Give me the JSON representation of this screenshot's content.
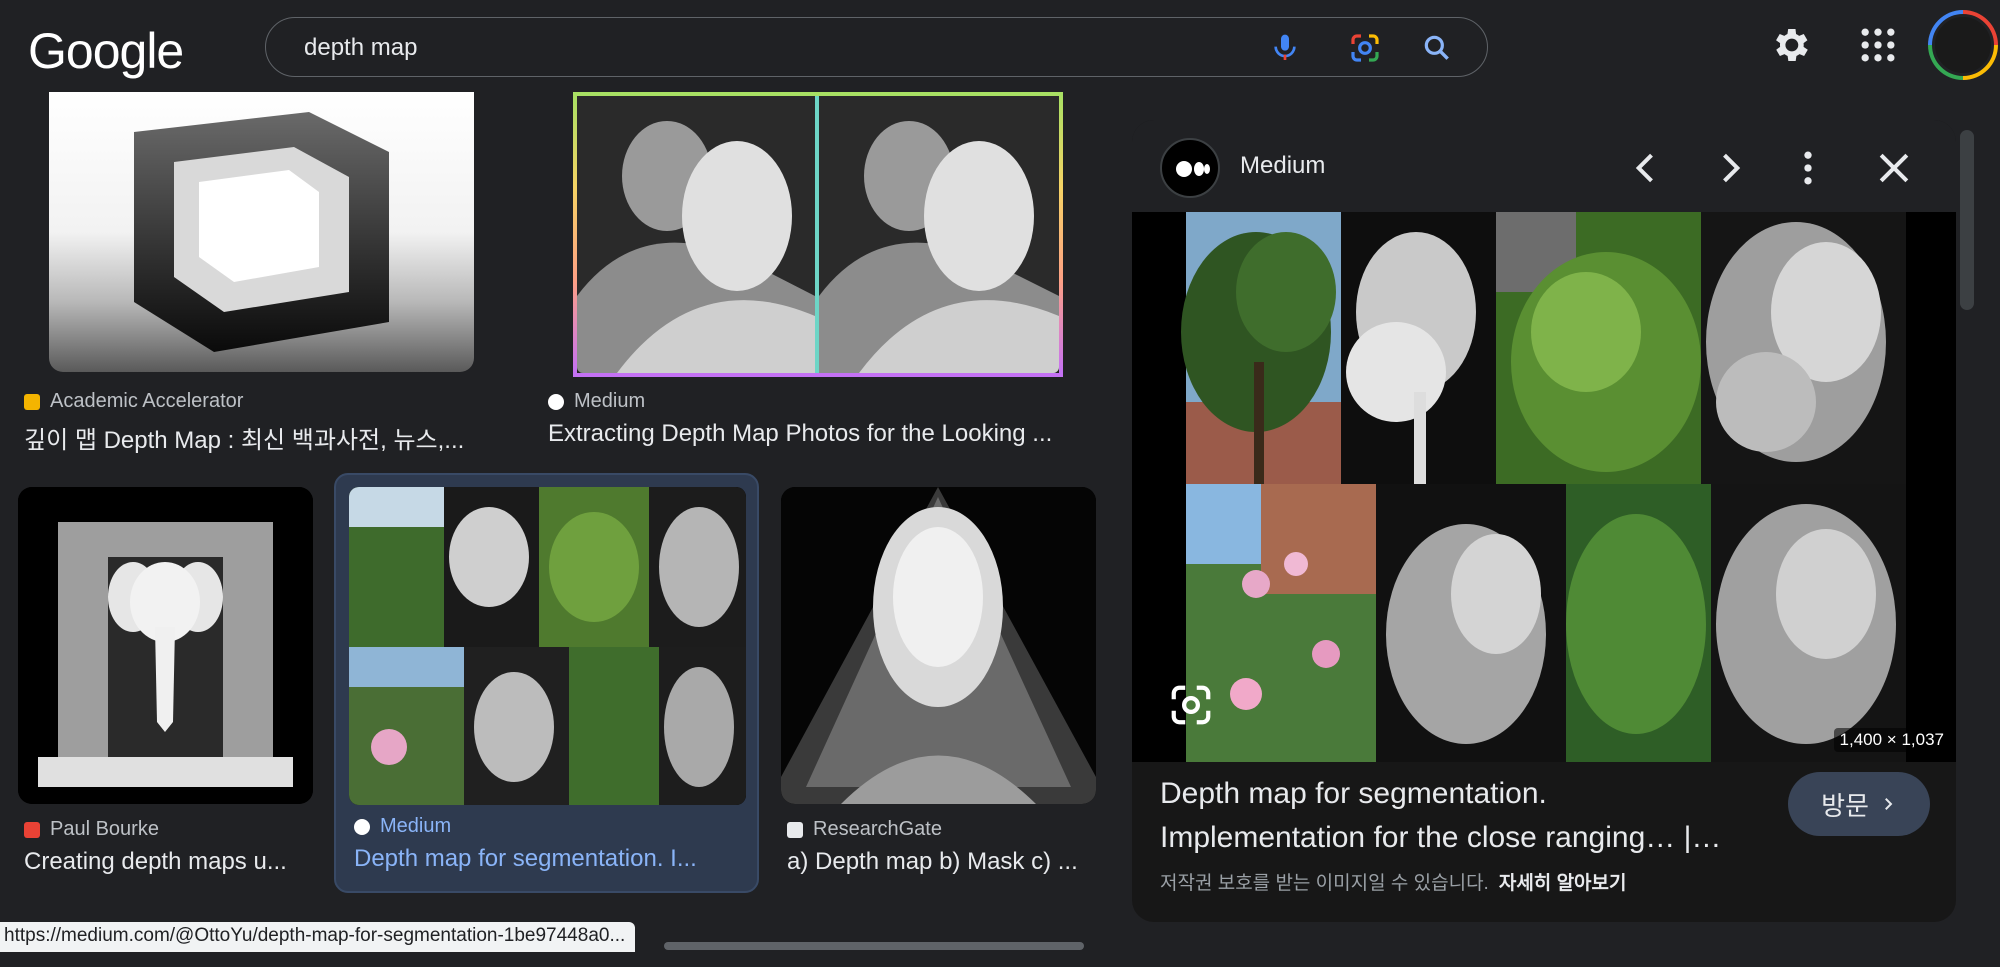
{
  "header": {
    "logo": "Google",
    "search_query": "depth map",
    "icons": [
      "mic-icon",
      "lens-icon",
      "search-icon",
      "settings-icon",
      "apps-icon"
    ]
  },
  "results": [
    {
      "source": "Academic Accelerator",
      "title": "깊이 맵 Depth Map : 최신 백과사전, 뉴스,..."
    },
    {
      "source": "Medium",
      "title": "Extracting Depth Map Photos for the Looking ..."
    },
    {
      "source": "Paul Bourke",
      "title": "Creating depth maps u..."
    },
    {
      "source": "Medium",
      "title": "Depth map for segmentation. I...",
      "selected": true
    },
    {
      "source": "ResearchGate",
      "title": "a) Depth map b) Mask c) ..."
    }
  ],
  "panel": {
    "source": "Medium",
    "title_line1": "Depth map for segmentation.",
    "title_line2": "Implementation for the close ranging… |…",
    "dimensions": "1,400 × 1,037",
    "visit_label": "방문",
    "copyright": "저작권 보호를 받는 이미지일 수 있습니다.",
    "learn_more": "자세히 알아보기"
  },
  "status_url": "https://medium.com/@OttoYu/depth-map-for-segmentation-1be97448a0..."
}
